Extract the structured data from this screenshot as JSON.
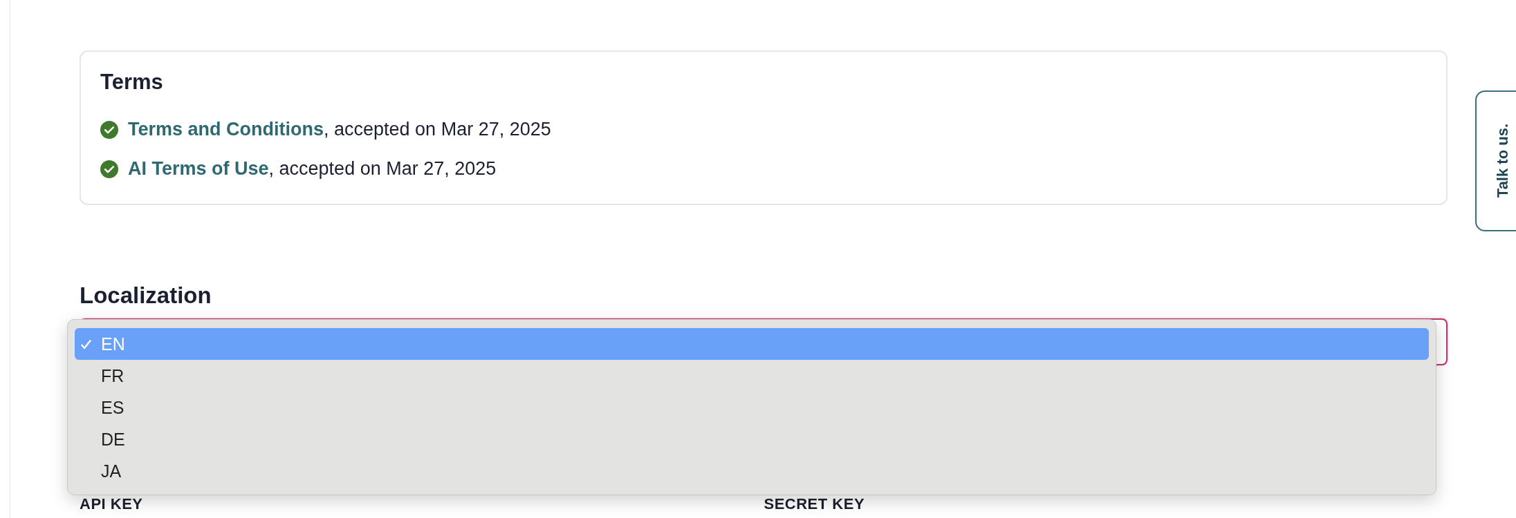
{
  "terms": {
    "title": "Terms",
    "items": [
      {
        "link": "Terms and Conditions",
        "text": ", accepted on Mar 27, 2025",
        "accepted": true
      },
      {
        "link": "AI Terms of Use",
        "text": ", accepted on Mar 27, 2025",
        "accepted": true
      }
    ]
  },
  "localization": {
    "title": "Localization",
    "options": [
      {
        "label": "EN",
        "selected": true
      },
      {
        "label": "FR",
        "selected": false
      },
      {
        "label": "ES",
        "selected": false
      },
      {
        "label": "DE",
        "selected": false
      },
      {
        "label": "JA",
        "selected": false
      }
    ]
  },
  "credentials": {
    "labels": [
      "API KEY",
      "SECRET KEY"
    ]
  },
  "feedback_tab": {
    "label": "Talk to us."
  }
}
